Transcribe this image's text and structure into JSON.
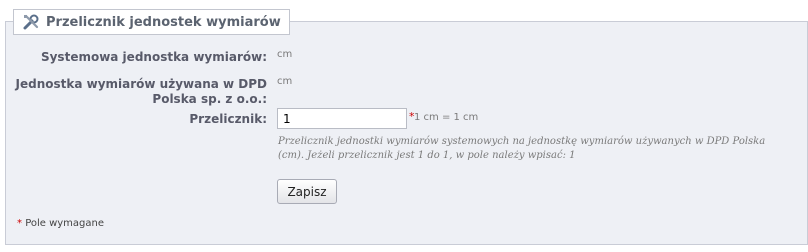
{
  "panel": {
    "title": "Przelicznik jednostek wymiarów",
    "icon": "tools-icon"
  },
  "fields": {
    "system_unit": {
      "label": "Systemowa jednostka wymiarów:",
      "value": "cm"
    },
    "dpd_unit": {
      "label_line1": "Jednostka wymiarów używana w DPD",
      "label_line2": "Polska sp. z o.o.:",
      "value": "cm"
    },
    "converter": {
      "label": "Przelicznik:",
      "value": "1",
      "required_mark": "*",
      "hint": "1 cm = 1 cm",
      "description_line1": "Przelicznik jednostki wymiarów systemowych na jednostkę wymiarów używanych w DPD Polska",
      "description_line2": "(cm). Jeżeli przelicznik jest 1 do 1, w pole należy wpisać: 1"
    }
  },
  "actions": {
    "save_label": "Zapisz"
  },
  "footer": {
    "required_mark": "*",
    "required_text": "Pole wymagane"
  },
  "colors": {
    "panel_bg": "#eef0f5",
    "label": "#585a69",
    "required": "#cc0000"
  }
}
